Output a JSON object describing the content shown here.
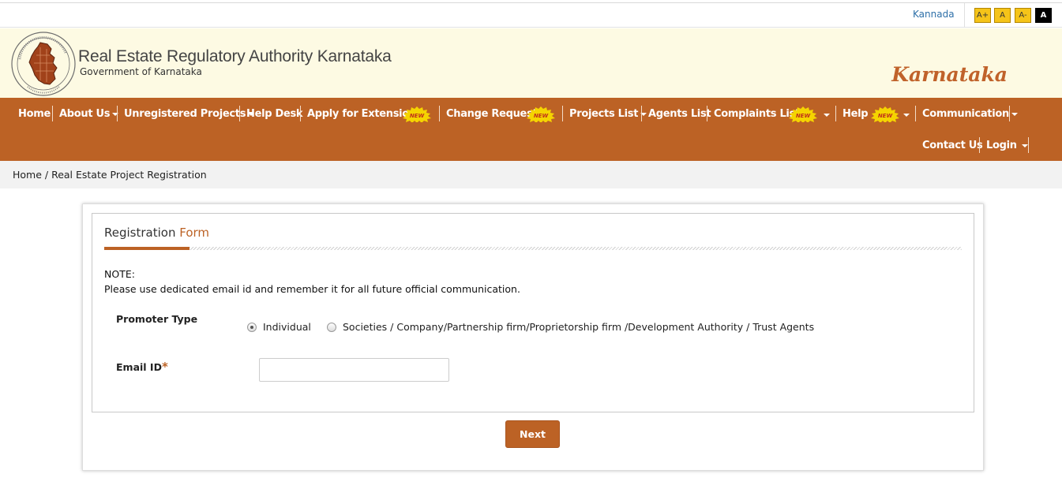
{
  "topbar": {
    "language_link": "Kannada",
    "font_buttons": [
      "A+",
      "A",
      "A-",
      "A"
    ]
  },
  "header": {
    "title": "Real Estate Regulatory Authority Karnataka",
    "subtitle": "Government of Karnataka",
    "state_label": "Karnataka",
    "logo_icon": "karnataka-map-emblem-icon"
  },
  "nav": {
    "items": [
      {
        "label": "Home"
      },
      {
        "label": "About Us"
      },
      {
        "label": "Unregistered Projects"
      },
      {
        "label": "Help Desk"
      },
      {
        "label": "Apply for Extension",
        "badge": "NEW"
      },
      {
        "label": "Change Request",
        "badge": "NEW"
      },
      {
        "label": "Projects List"
      },
      {
        "label": "Agents List"
      },
      {
        "label": "Complaints List",
        "badge": "NEW"
      },
      {
        "label": "Help",
        "badge": "NEW"
      },
      {
        "label": "Communication"
      },
      {
        "label": "Contact Us"
      },
      {
        "label": "Login"
      }
    ],
    "badge_text": "NEW"
  },
  "breadcrumb": {
    "text": "Home / Real Estate Project Registration"
  },
  "form": {
    "title_part1": "Registration",
    "title_part2": "Form",
    "note_label": "NOTE:",
    "note_text": "Please use dedicated email id and remember it for all future official communication.",
    "promoter_type_label": "Promoter Type",
    "promoter_options": [
      {
        "label": "Individual",
        "selected": true
      },
      {
        "label": "Societies / Company/Partnership firm/Proprietorship firm /Development Authority / Trust Agents",
        "selected": false
      }
    ],
    "email_label": "Email ID",
    "required_mark": "*",
    "email_value": "",
    "next_label": "Next"
  },
  "colors": {
    "brand": "#bc6225",
    "header_bg": "#fdfae3",
    "badge_yellow": "#f5d400"
  }
}
